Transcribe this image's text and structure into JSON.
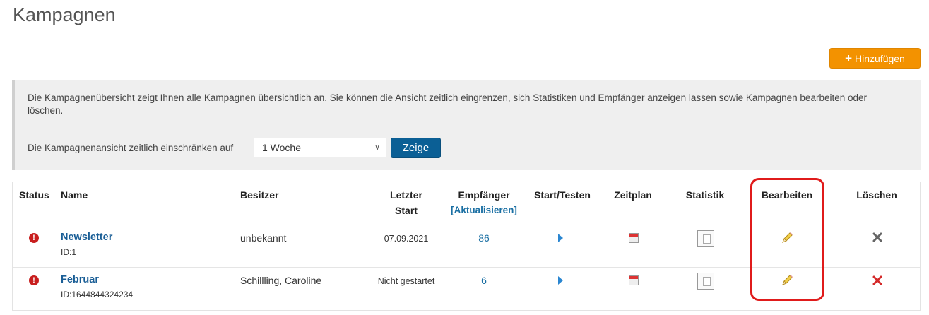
{
  "page": {
    "title": "Kampagnen",
    "add_button_label": "Hinzufügen"
  },
  "info": {
    "description": "Die Kampagnenübersicht zeigt Ihnen alle Kampagnen übersichtlich an. Sie können die Ansicht zeitlich eingrenzen, sich Statistiken und Empfänger anzeigen lassen sowie Kampagnen bearbeiten oder löschen.",
    "filter_label": "Die Kampagnenansicht zeitlich einschränken auf",
    "filter_value": "1 Woche",
    "show_button_label": "Zeige"
  },
  "table": {
    "headers": {
      "status": "Status",
      "name": "Name",
      "owner": "Besitzer",
      "last_start_line1": "Letzter",
      "last_start_line2": "Start",
      "recipients": "Empfänger",
      "refresh": "[Aktualisieren]",
      "start_test": "Start/Testen",
      "schedule": "Zeitplan",
      "statistics": "Statistik",
      "edit": "Bearbeiten",
      "delete": "Löschen"
    },
    "rows": [
      {
        "name": "Newsletter",
        "id": "ID:1",
        "owner": "unbekannt",
        "last_start": "07.09.2021",
        "recipients": "86",
        "delete_color": "#666666"
      },
      {
        "name": "Februar",
        "id": "ID:1644844324234",
        "owner": "Schillling, Caroline",
        "last_start": "Nicht gestartet",
        "recipients": "6",
        "delete_color": "#d42a2a"
      }
    ]
  },
  "colors": {
    "accent_orange": "#f39200",
    "primary_blue": "#0b5f95",
    "link_blue": "#1a5e96",
    "status_error": "#c81e1e",
    "highlight_red": "#e01b1b"
  },
  "icons": {
    "status": "exclamation-circle-icon",
    "start": "play-icon",
    "schedule": "calendar-icon",
    "statistics": "statistics-document-icon",
    "edit": "pencil-icon",
    "delete": "x-icon"
  }
}
